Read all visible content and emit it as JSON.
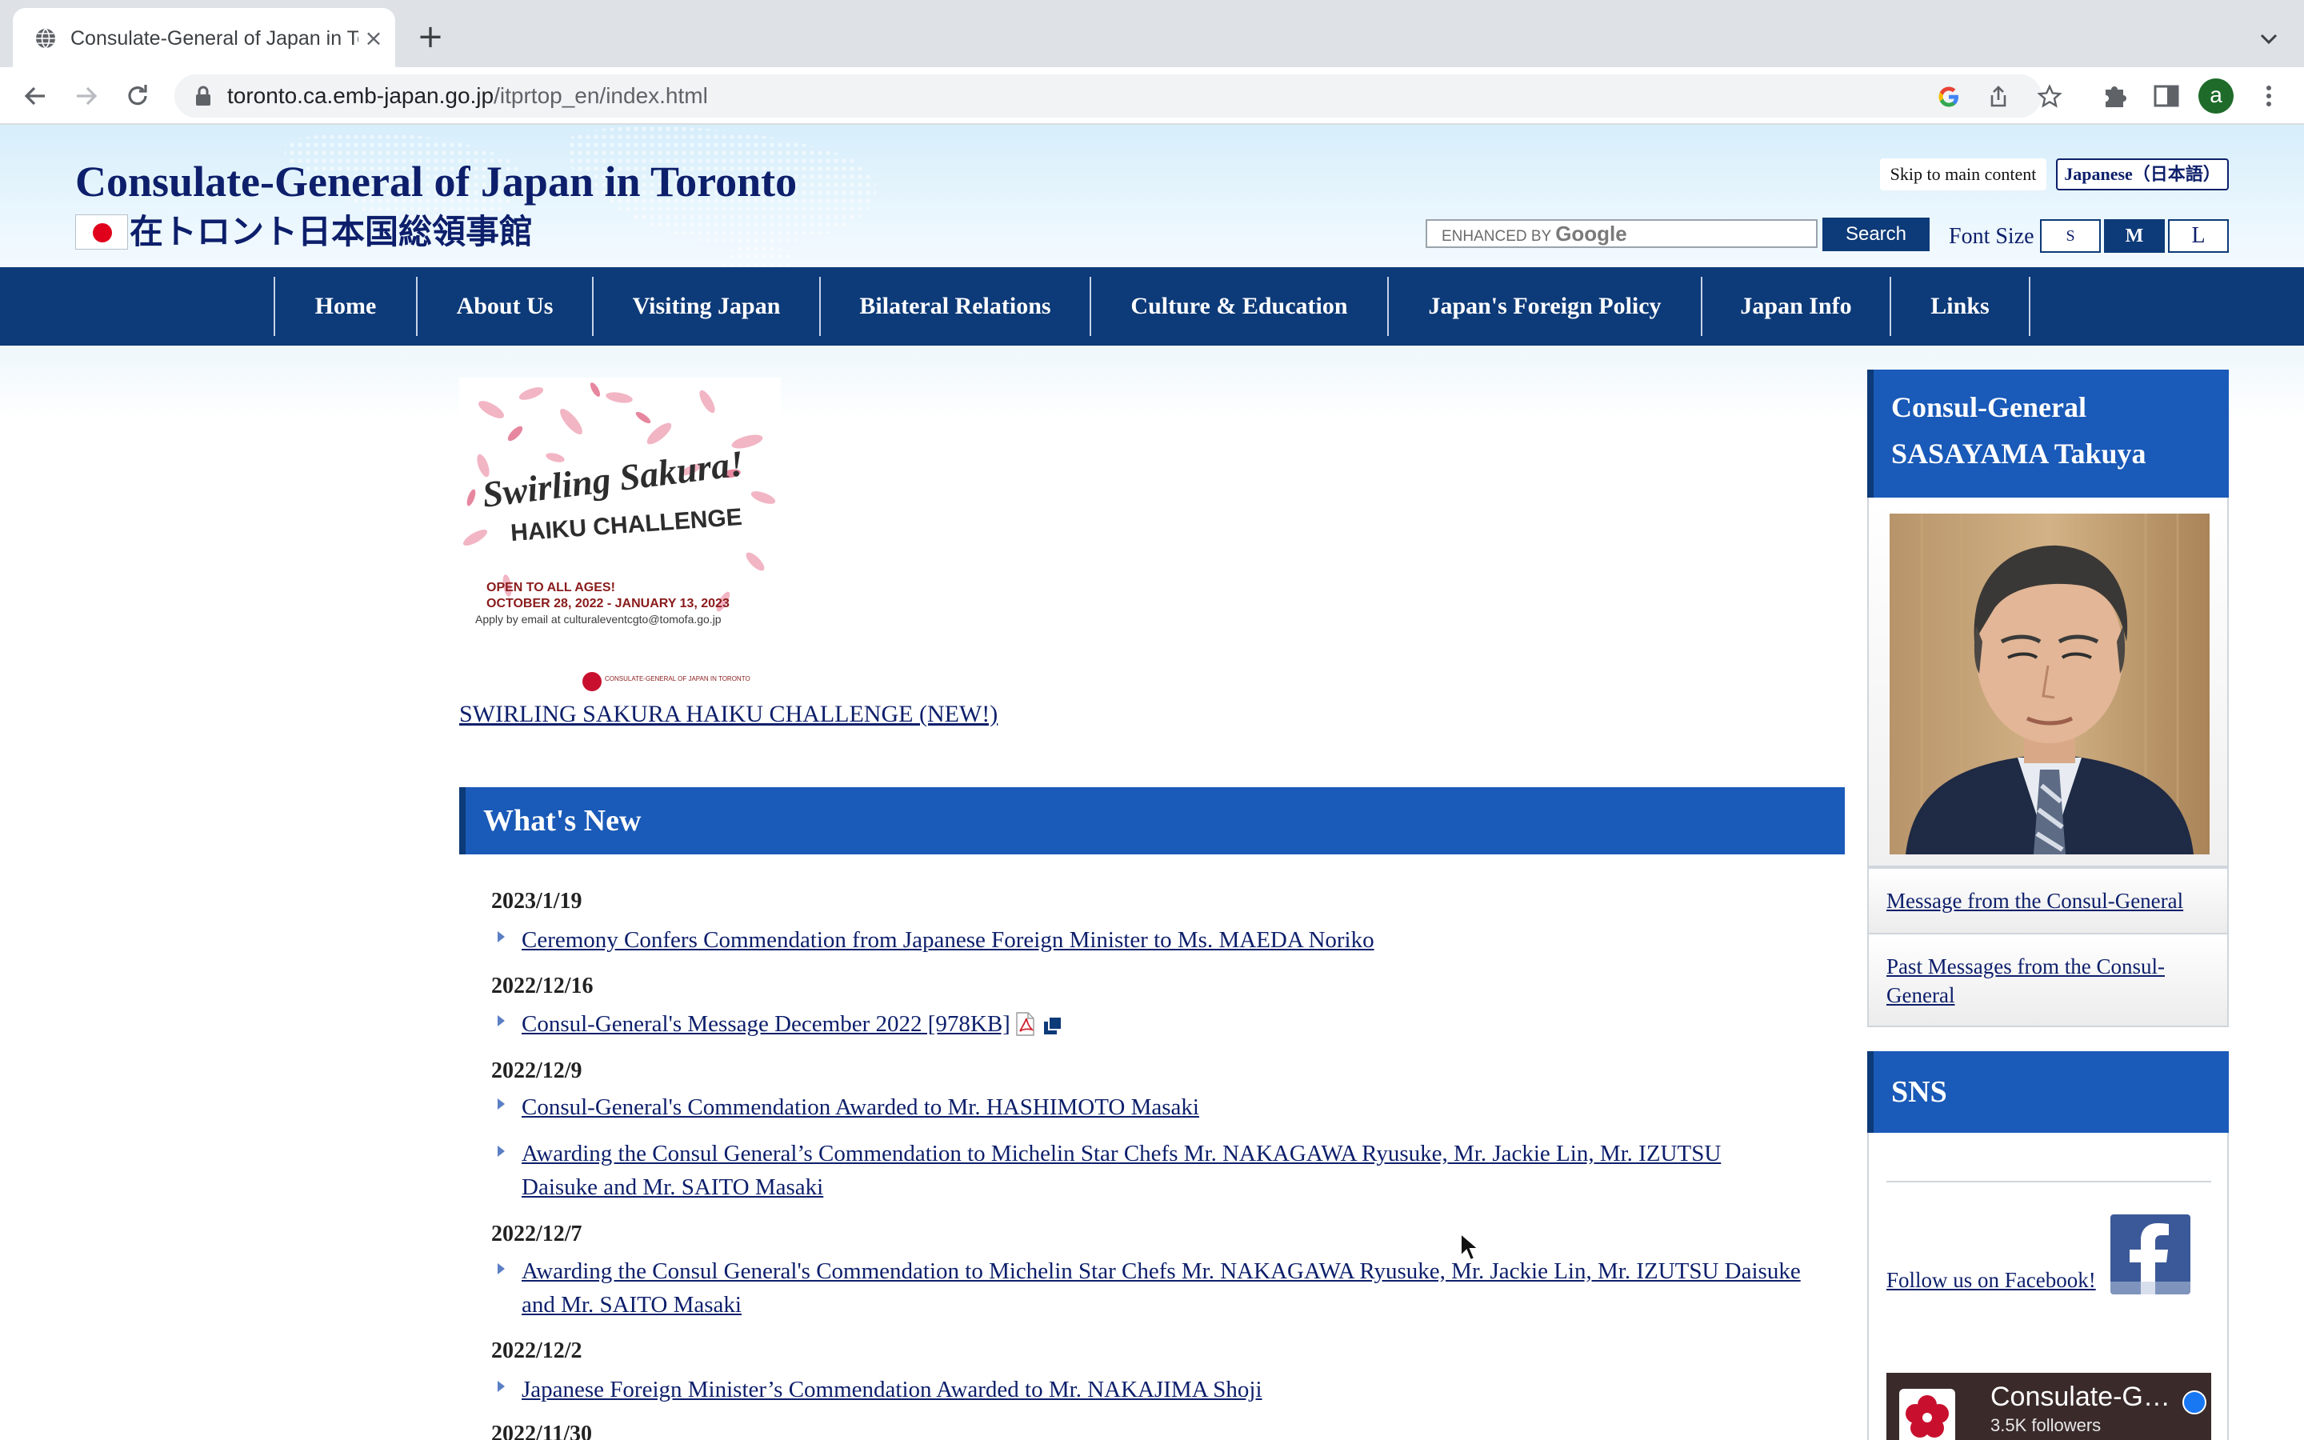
{
  "browser": {
    "tab_title": "Consulate-General of Japan in Toronto",
    "tab_close": "×",
    "new_tab": "+",
    "url_host": "toronto.ca.emb-japan.go.jp",
    "url_path": "/itprtop_en/index.html",
    "profile_initial": "a"
  },
  "header": {
    "title_en": "Consulate-General of Japan in Toronto",
    "title_ja": "在トロント日本国総領事館",
    "skip_link": "Skip to main content",
    "language_button": "Japanese（日本語）",
    "search_placeholder_prefix": "ENHANCED BY",
    "search_placeholder_brand": "Google",
    "search_button": "Search",
    "font_size_label": "Font Size",
    "font_sizes": [
      "S",
      "M",
      "L"
    ],
    "font_size_selected": "M"
  },
  "nav": {
    "items": [
      "Home",
      "About Us",
      "Visiting Japan",
      "Bilateral Relations",
      "Culture & Education",
      "Japan's Foreign Policy",
      "Japan Info",
      "Links"
    ]
  },
  "banner": {
    "title_line1": "Swirling Sakura!",
    "title_line2": "HAIKU CHALLENGE",
    "line1": "OPEN TO ALL AGES!",
    "line2": "OCTOBER 28, 2022 - JANUARY 13, 2023",
    "line3": "Apply by email at culturaleventcgto@tomofa.go.jp",
    "logo_text": "CONSULATE-GENERAL OF JAPAN IN TORONTO",
    "link": "SWIRLING SAKURA HAIKU CHALLENGE (NEW!)"
  },
  "whats_new": {
    "title": "What's New",
    "groups": [
      {
        "date": "2023/1/19",
        "items": [
          "Ceremony Confers Commendation from Japanese Foreign Minister to Ms. MAEDA Noriko"
        ]
      },
      {
        "date": "2022/12/16",
        "items": [
          "Consul-General's Message December 2022 [978KB]"
        ]
      },
      {
        "date": "2022/12/9",
        "items": [
          "Consul-General's Commendation Awarded to Mr. HASHIMOTO Masaki",
          "Awarding the Consul General’s Commendation to Michelin Star Chefs Mr. NAKAGAWA Ryusuke, Mr. Jackie Lin, Mr. IZUTSU Daisuke and Mr. SAITO Masaki"
        ]
      },
      {
        "date": "2022/12/7",
        "items": [
          "Awarding the Consul General's Commendation to Michelin Star Chefs Mr. NAKAGAWA Ryusuke, Mr. Jackie Lin, Mr. IZUTSU Daisuke and Mr. SAITO Masaki"
        ]
      },
      {
        "date": "2022/12/2",
        "items": [
          "Japanese Foreign Minister’s Commendation Awarded to Mr. NAKAJIMA Shoji"
        ]
      },
      {
        "date": "2022/11/30",
        "items": []
      }
    ]
  },
  "sidebar": {
    "cg_heading_line1": "Consul-General",
    "cg_heading_line2": "SASAYAMA Takuya",
    "links": [
      "Message from the Consul-General",
      "Past Messages from the Consul-General"
    ],
    "sns_title": "SNS",
    "facebook_follow": "Follow us on Facebook!",
    "fb_widget_name": "Consulate-General of Japan in Toronto",
    "fb_widget_followers": "3.5K followers"
  },
  "colors": {
    "brand_navy": "#0d3a78",
    "heading_blue": "#1a5ab8",
    "link_navy": "#0d1f6b",
    "header_sky": "#d6eefb"
  },
  "icons": {
    "tab_favicon": "globe-icon",
    "lock": "lock-icon",
    "google": "google-icon",
    "share": "share-icon",
    "bookmark": "star-icon",
    "extensions": "puzzle-icon",
    "side_panel": "side-panel-icon",
    "menu": "kebab-menu-icon",
    "pdf": "pdf-icon",
    "external": "external-window-icon",
    "facebook": "facebook-icon"
  }
}
